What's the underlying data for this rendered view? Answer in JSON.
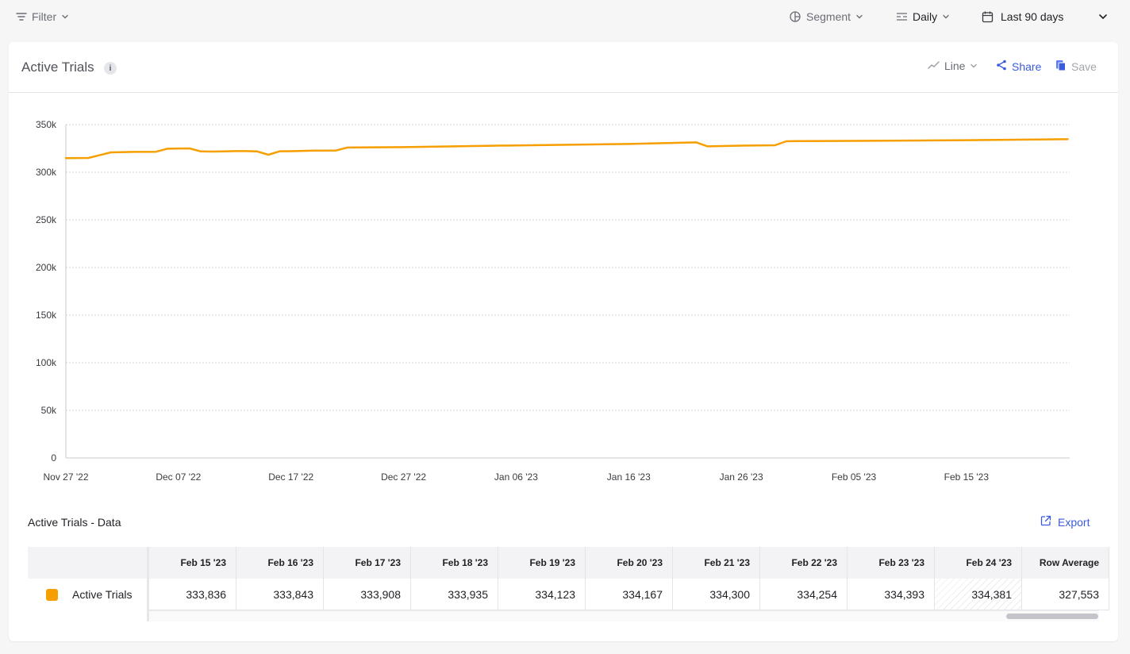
{
  "toolbar": {
    "filter_label": "Filter",
    "segment_label": "Segment",
    "interval_label": "Daily",
    "date_range_label": "Last 90 days"
  },
  "card": {
    "title": "Active Trials",
    "info_glyph": "i",
    "chart_type_label": "Line",
    "share_label": "Share",
    "save_label": "Save"
  },
  "colors": {
    "series": "#f59f00",
    "accent": "#3b5bdb",
    "muted": "#9a9ca4"
  },
  "chart_data": {
    "type": "line",
    "title": "Active Trials",
    "ylim": [
      0,
      350000
    ],
    "y_ticks": [
      0,
      50000,
      100000,
      150000,
      200000,
      250000,
      300000,
      350000
    ],
    "y_tick_labels": [
      "0",
      "50k",
      "100k",
      "150k",
      "200k",
      "250k",
      "300k",
      "350k"
    ],
    "x_tick_labels": [
      "Nov 27 '22",
      "Dec 07 '22",
      "Dec 17 '22",
      "Dec 27 '22",
      "Jan 06 '23",
      "Jan 16 '23",
      "Jan 26 '23",
      "Feb 05 '23",
      "Feb 15 '23"
    ],
    "x_start": "Nov 27 '22",
    "x_end": "Feb 24 '23",
    "grid": true,
    "series": [
      {
        "name": "Active Trials",
        "x": [
          "2022-11-27",
          "2022-11-29",
          "2022-12-01",
          "2022-12-03",
          "2022-12-05",
          "2022-12-06",
          "2022-12-07",
          "2022-12-08",
          "2022-12-09",
          "2022-12-10",
          "2022-12-11",
          "2022-12-12",
          "2022-12-13",
          "2022-12-14",
          "2022-12-15",
          "2022-12-16",
          "2022-12-17",
          "2022-12-19",
          "2022-12-21",
          "2022-12-22",
          "2022-12-23",
          "2022-12-27",
          "2023-01-06",
          "2023-01-16",
          "2023-01-22",
          "2023-01-23",
          "2023-01-26",
          "2023-01-29",
          "2023-01-30",
          "2023-01-31",
          "2023-02-05",
          "2023-02-15",
          "2023-02-24"
        ],
        "y": [
          314800,
          315000,
          320800,
          321300,
          321500,
          324700,
          324900,
          325000,
          321800,
          321700,
          321800,
          322200,
          322200,
          321800,
          318300,
          322000,
          322100,
          322700,
          322800,
          325900,
          326000,
          326300,
          328200,
          329700,
          331300,
          327200,
          327900,
          328300,
          332500,
          332700,
          332900,
          333700,
          334700
        ]
      }
    ]
  },
  "data_table": {
    "title": "Active Trials - Data",
    "export_label": "Export",
    "series_name": "Active Trials",
    "columns": [
      "Feb 15 '23",
      "Feb 16 '23",
      "Feb 17 '23",
      "Feb 18 '23",
      "Feb 19 '23",
      "Feb 20 '23",
      "Feb 21 '23",
      "Feb 22 '23",
      "Feb 23 '23",
      "Feb 24 '23",
      "Row Average"
    ],
    "values": [
      "333,836",
      "333,843",
      "333,908",
      "333,935",
      "334,123",
      "334,167",
      "334,300",
      "334,254",
      "334,393",
      "334,381",
      "327,553"
    ]
  }
}
